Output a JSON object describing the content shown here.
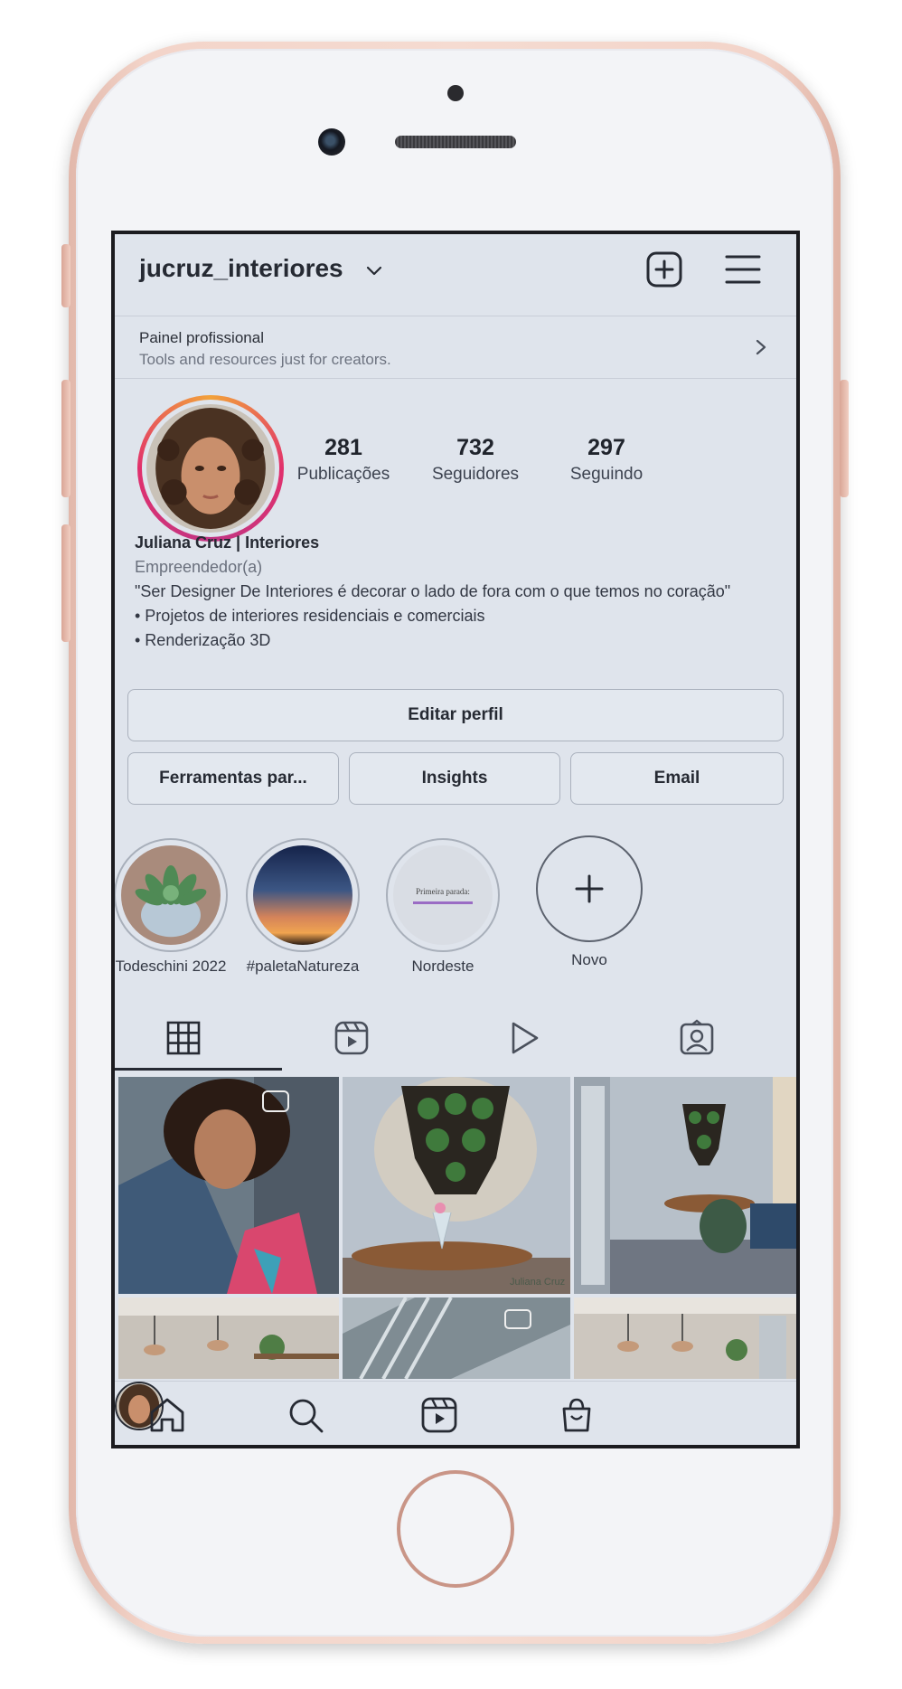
{
  "profile": {
    "username": "jucruz_interiores",
    "pro_panel_title": "Painel profissional",
    "pro_panel_subtitle": "Tools and resources just for creators.",
    "posts_count": "281",
    "posts_label": "Publicações",
    "followers_count": "732",
    "followers_label": "Seguidores",
    "following_count": "297",
    "following_label": "Seguindo",
    "display_name": "Juliana Cruz | Interiores",
    "category": "Empreendedor(a)",
    "bio_line1": "\"Ser Designer De Interiores é decorar o lado de fora com o que temos no coração\"",
    "bio_line2": "• Projetos de interiores residenciais e comerciais",
    "bio_line3": "• Renderização 3D"
  },
  "buttons": {
    "edit_profile": "Editar perfil",
    "tools": "Ferramentas par...",
    "insights": "Insights",
    "email": "Email"
  },
  "highlights": [
    {
      "label": "Todeschini 2022"
    },
    {
      "label": "#paletaNatureza"
    },
    {
      "label": "Nordeste",
      "cover_text": "Primeira parada:"
    },
    {
      "label": "Novo"
    }
  ],
  "tabs": [
    "grid-icon",
    "reels-icon",
    "video-icon",
    "tagged-icon"
  ],
  "posts": {
    "watermark": "Juliana Cruz"
  },
  "nav": [
    "home-icon",
    "search-icon",
    "reels-icon",
    "shop-icon",
    "profile-avatar"
  ],
  "colors": {
    "screen_bg": "#dfe4ec",
    "text": "#262a33",
    "story_ring_start": "#f2a23a",
    "story_ring_end": "#c13584",
    "phone_frame": "#f3d4c9"
  }
}
